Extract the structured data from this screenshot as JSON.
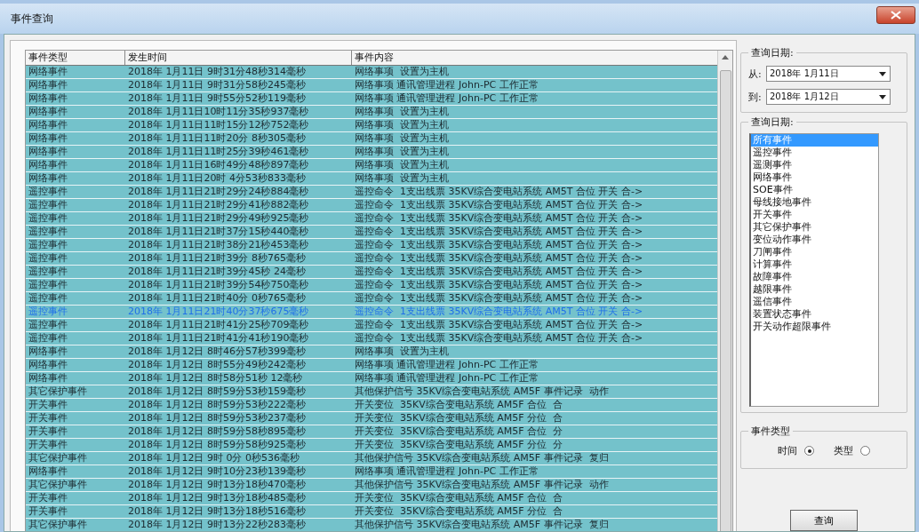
{
  "window": {
    "title": "事件查询"
  },
  "table": {
    "columns": [
      "事件类型",
      "发生时间",
      "事件内容"
    ],
    "rows": [
      {
        "type": "网络事件",
        "time": "2018年 1月11日 9时31分48秒314毫秒",
        "content": "网络事项  设置为主机",
        "selected": false
      },
      {
        "type": "网络事件",
        "time": "2018年 1月11日 9时31分58秒245毫秒",
        "content": "网络事项 通讯管理进程 John-PC 工作正常",
        "selected": false
      },
      {
        "type": "网络事件",
        "time": "2018年 1月11日 9时55分52秒119毫秒",
        "content": "网络事项 通讯管理进程 John-PC 工作正常",
        "selected": false
      },
      {
        "type": "网络事件",
        "time": "2018年 1月11日10时11分35秒937毫秒",
        "content": "网络事项  设置为主机",
        "selected": false
      },
      {
        "type": "网络事件",
        "time": "2018年 1月11日11时15分12秒752毫秒",
        "content": "网络事项  设置为主机",
        "selected": false
      },
      {
        "type": "网络事件",
        "time": "2018年 1月11日11时20分 8秒305毫秒",
        "content": "网络事项  设置为主机",
        "selected": false
      },
      {
        "type": "网络事件",
        "time": "2018年 1月11日11时25分39秒461毫秒",
        "content": "网络事项  设置为主机",
        "selected": false
      },
      {
        "type": "网络事件",
        "time": "2018年 1月11日16时49分48秒897毫秒",
        "content": "网络事项  设置为主机",
        "selected": false
      },
      {
        "type": "网络事件",
        "time": "2018年 1月11日20时 4分53秒833毫秒",
        "content": "网络事项  设置为主机",
        "selected": false
      },
      {
        "type": "遥控事件",
        "time": "2018年 1月11日21时29分24秒884毫秒",
        "content": "遥控命令  1支出线票 35KV综合变电站系统 AM5T 合位 开关 合->",
        "selected": false
      },
      {
        "type": "遥控事件",
        "time": "2018年 1月11日21时29分41秒882毫秒",
        "content": "遥控命令  1支出线票 35KV综合变电站系统 AM5T 合位 开关 合->",
        "selected": false
      },
      {
        "type": "遥控事件",
        "time": "2018年 1月11日21时29分49秒925毫秒",
        "content": "遥控命令  1支出线票 35KV综合变电站系统 AM5T 合位 开关 合->",
        "selected": false
      },
      {
        "type": "遥控事件",
        "time": "2018年 1月11日21时37分15秒440毫秒",
        "content": "遥控命令  1支出线票 35KV综合变电站系统 AM5T 合位 开关 合->",
        "selected": false
      },
      {
        "type": "遥控事件",
        "time": "2018年 1月11日21时38分21秒453毫秒",
        "content": "遥控命令  1支出线票 35KV综合变电站系统 AM5T 合位 开关 合->",
        "selected": false
      },
      {
        "type": "遥控事件",
        "time": "2018年 1月11日21时39分 8秒765毫秒",
        "content": "遥控命令  1支出线票 35KV综合变电站系统 AM5T 合位 开关 合->",
        "selected": false
      },
      {
        "type": "遥控事件",
        "time": "2018年 1月11日21时39分45秒 24毫秒",
        "content": "遥控命令  1支出线票 35KV综合变电站系统 AM5T 合位 开关 合->",
        "selected": false
      },
      {
        "type": "遥控事件",
        "time": "2018年 1月11日21时39分54秒750毫秒",
        "content": "遥控命令  1支出线票 35KV综合变电站系统 AM5T 合位 开关 合->",
        "selected": false
      },
      {
        "type": "遥控事件",
        "time": "2018年 1月11日21时40分 0秒765毫秒",
        "content": "遥控命令  1支出线票 35KV综合变电站系统 AM5T 合位 开关 合->",
        "selected": false
      },
      {
        "type": "遥控事件",
        "time": "2018年 1月11日21时40分37秒675毫秒",
        "content": "遥控命令  1支出线票 35KV综合变电站系统 AM5T 合位 开关 合->",
        "selected": true
      },
      {
        "type": "遥控事件",
        "time": "2018年 1月11日21时41分25秒709毫秒",
        "content": "遥控命令  1支出线票 35KV综合变电站系统 AM5T 合位 开关 合->",
        "selected": false
      },
      {
        "type": "遥控事件",
        "time": "2018年 1月11日21时41分41秒190毫秒",
        "content": "遥控命令  1支出线票 35KV综合变电站系统 AM5T 合位 开关 合->",
        "selected": false
      },
      {
        "type": "网络事件",
        "time": "2018年 1月12日 8时46分57秒399毫秒",
        "content": "网络事项  设置为主机",
        "selected": false
      },
      {
        "type": "网络事件",
        "time": "2018年 1月12日 8时55分49秒242毫秒",
        "content": "网络事项 通讯管理进程 John-PC 工作正常",
        "selected": false
      },
      {
        "type": "网络事件",
        "time": "2018年 1月12日 8时58分51秒 12毫秒",
        "content": "网络事项 通讯管理进程 John-PC 工作正常",
        "selected": false
      },
      {
        "type": "其它保护事件",
        "time": "2018年 1月12日 8时59分53秒159毫秒",
        "content": "其他保护信号 35KV综合变电站系统 AM5F 事件记录  动作",
        "selected": false
      },
      {
        "type": "开关事件",
        "time": "2018年 1月12日 8时59分53秒222毫秒",
        "content": "开关变位  35KV综合变电站系统 AM5F 合位  合",
        "selected": false
      },
      {
        "type": "开关事件",
        "time": "2018年 1月12日 8时59分53秒237毫秒",
        "content": "开关变位  35KV综合变电站系统 AM5F 分位  合",
        "selected": false
      },
      {
        "type": "开关事件",
        "time": "2018年 1月12日 8时59分58秒895毫秒",
        "content": "开关变位  35KV综合变电站系统 AM5F 合位  分",
        "selected": false
      },
      {
        "type": "开关事件",
        "time": "2018年 1月12日 8时59分58秒925毫秒",
        "content": "开关变位  35KV综合变电站系统 AM5F 分位  分",
        "selected": false
      },
      {
        "type": "其它保护事件",
        "time": "2018年 1月12日 9时 0分 0秒536毫秒",
        "content": "其他保护信号 35KV综合变电站系统 AM5F 事件记录  复归",
        "selected": false
      },
      {
        "type": "网络事件",
        "time": "2018年 1月12日 9时10分23秒139毫秒",
        "content": "网络事项 通讯管理进程 John-PC 工作正常",
        "selected": false
      },
      {
        "type": "其它保护事件",
        "time": "2018年 1月12日 9时13分18秒470毫秒",
        "content": "其他保护信号 35KV综合变电站系统 AM5F 事件记录  动作",
        "selected": false
      },
      {
        "type": "开关事件",
        "time": "2018年 1月12日 9时13分18秒485毫秒",
        "content": "开关变位  35KV综合变电站系统 AM5F 合位  合",
        "selected": false
      },
      {
        "type": "开关事件",
        "time": "2018年 1月12日 9时13分18秒516毫秒",
        "content": "开关变位  35KV综合变电站系统 AM5F 分位  合",
        "selected": false
      },
      {
        "type": "其它保护事件",
        "time": "2018年 1月12日 9时13分22秒283毫秒",
        "content": "其他保护信号 35KV综合变电站系统 AM5F 事件记录  复归",
        "selected": false
      }
    ]
  },
  "date_range": {
    "title": "查询日期:",
    "from_label": "从:",
    "from_value": "2018年 1月11日",
    "to_label": "到:",
    "to_value": "2018年 1月12日"
  },
  "event_list": {
    "title": "查询日期:",
    "items": [
      {
        "label": "所有事件",
        "selected": true
      },
      {
        "label": "遥控事件",
        "selected": false
      },
      {
        "label": "遥测事件",
        "selected": false
      },
      {
        "label": "网络事件",
        "selected": false
      },
      {
        "label": "SOE事件",
        "selected": false
      },
      {
        "label": "母线接地事件",
        "selected": false
      },
      {
        "label": "开关事件",
        "selected": false
      },
      {
        "label": "其它保护事件",
        "selected": false
      },
      {
        "label": "变位动作事件",
        "selected": false
      },
      {
        "label": "刀闸事件",
        "selected": false
      },
      {
        "label": "计算事件",
        "selected": false
      },
      {
        "label": "故障事件",
        "selected": false
      },
      {
        "label": "越限事件",
        "selected": false
      },
      {
        "label": "遥信事件",
        "selected": false
      },
      {
        "label": "装置状态事件",
        "selected": false
      },
      {
        "label": "开关动作超限事件",
        "selected": false
      }
    ]
  },
  "sort_group": {
    "title": "事件类型",
    "options": [
      {
        "label": "时间",
        "selected": true
      },
      {
        "label": "类型",
        "selected": false
      }
    ]
  },
  "query_button": "查询"
}
